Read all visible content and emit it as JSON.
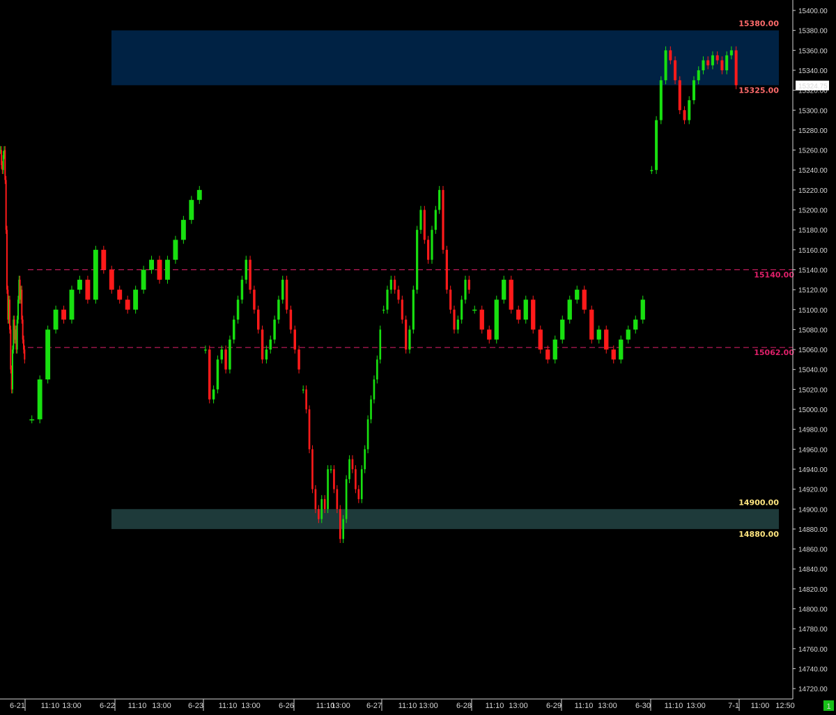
{
  "chart_data": {
    "type": "candlestick",
    "title": "",
    "xlabel": "",
    "ylabel": "",
    "ylim": [
      14710,
      15410
    ],
    "y_ticks": [
      15400,
      15380,
      15360,
      15340,
      15320,
      15300,
      15280,
      15260,
      15240,
      15220,
      15200,
      15180,
      15160,
      15140,
      15120,
      15100,
      15080,
      15060,
      15040,
      15020,
      15000,
      14980,
      14960,
      14940,
      14920,
      14900,
      14880,
      14860,
      14840,
      14820,
      14800,
      14780,
      14760,
      14740,
      14720
    ],
    "x_labels": [
      {
        "text": "6-21",
        "date": true
      },
      {
        "text": "11:10"
      },
      {
        "text": "13:00"
      },
      {
        "text": "6-22",
        "date": true
      },
      {
        "text": "11:10"
      },
      {
        "text": "13:00"
      },
      {
        "text": "6-23",
        "date": true
      },
      {
        "text": "11:10"
      },
      {
        "text": "13:00"
      },
      {
        "text": "6-26",
        "date": true
      },
      {
        "text": "11:10"
      },
      {
        "text": "13:00"
      },
      {
        "text": "6-27",
        "date": true
      },
      {
        "text": "11:10"
      },
      {
        "text": "13:00"
      },
      {
        "text": "6-28",
        "date": true
      },
      {
        "text": "11:10"
      },
      {
        "text": "13:00"
      },
      {
        "text": "6-29",
        "date": true
      },
      {
        "text": "11:10"
      },
      {
        "text": "13:00"
      },
      {
        "text": "6-30",
        "date": true
      },
      {
        "text": "11:10"
      },
      {
        "text": "13:00"
      },
      {
        "text": "7-1",
        "date": true
      },
      {
        "text": "11:00"
      },
      {
        "text": "12:50"
      }
    ],
    "series": [
      {
        "session": "6-21",
        "values": [
          15260,
          15245,
          15240,
          15255,
          15260,
          15230,
          15180,
          15120,
          15090,
          15110,
          15080,
          15040,
          15020,
          15060,
          15090,
          15070,
          15080,
          15060,
          15090,
          15110,
          15130,
          15110,
          15120,
          15090,
          15070,
          15060,
          15050
        ]
      },
      {
        "session": "6-22",
        "values": [
          14990,
          15030,
          15080,
          15100,
          15090,
          15120,
          15130,
          15110,
          15160,
          15140,
          15120,
          15110,
          15100,
          15120,
          15140,
          15150,
          15130,
          15150,
          15170,
          15190,
          15210,
          15220
        ]
      },
      {
        "session": "6-23",
        "values": [
          15060,
          15010,
          15020,
          15050,
          15060,
          15040,
          15070,
          15090,
          15110,
          15130,
          15150,
          15120,
          15100,
          15080,
          15050,
          15060,
          15070,
          15090,
          15110,
          15130,
          15100,
          15080,
          15060,
          15040
        ]
      },
      {
        "session": "6-26",
        "values": [
          15020,
          15000,
          14960,
          14920,
          14900,
          14890,
          14910,
          14900,
          14940,
          14940,
          14920,
          14900,
          14870,
          14890,
          14930,
          14950,
          14940,
          14920,
          14910,
          14940,
          14960,
          14990,
          15010,
          15030,
          15050,
          15080
        ]
      },
      {
        "session": "6-27",
        "values": [
          15100,
          15120,
          15130,
          15120,
          15110,
          15090,
          15060,
          15080,
          15120,
          15180,
          15200,
          15170,
          15150,
          15180,
          15200,
          15220,
          15160,
          15120,
          15100,
          15080,
          15090,
          15110,
          15130,
          15120
        ]
      },
      {
        "session": "6-28",
        "values": [
          15100,
          15080,
          15070,
          15110,
          15130,
          15100,
          15090,
          15110,
          15080,
          15060,
          15050,
          15070,
          15090,
          15110,
          15120,
          15100,
          15070,
          15080,
          15060,
          15050,
          15070,
          15080,
          15090,
          15110
        ]
      },
      {
        "session": "6-30",
        "values": [
          15240,
          15290,
          15330,
          15360,
          15350,
          15330,
          15300,
          15290,
          15310,
          15330,
          15340,
          15350,
          15345,
          15355,
          15350,
          15340,
          15355,
          15360,
          15325
        ]
      }
    ],
    "last_price": "15324.75",
    "zones": [
      {
        "top": 15380,
        "bottom": 15325,
        "color": "#002244",
        "top_label": "15380.00",
        "bottom_label": "15325.00",
        "label_color": "#ff6b6b"
      },
      {
        "top": 14900,
        "bottom": 14880,
        "color": "#1e3a3a",
        "top_label": "14900.00",
        "bottom_label": "14880.00",
        "label_color": "#ffe680"
      }
    ],
    "lines": [
      {
        "value": 15140,
        "label": "15140.00",
        "color": "#e0206a"
      },
      {
        "value": 15062,
        "label": "15062.00",
        "color": "#e0206a"
      }
    ],
    "colors": {
      "up": "#18e010",
      "down": "#ff1a1a",
      "background": "#000000",
      "axis": "#d8d8d8",
      "price_box": "#ffffff",
      "corner_badge": "#18c018"
    },
    "grid": false,
    "legend": "none",
    "corner_badge_text": "1"
  }
}
